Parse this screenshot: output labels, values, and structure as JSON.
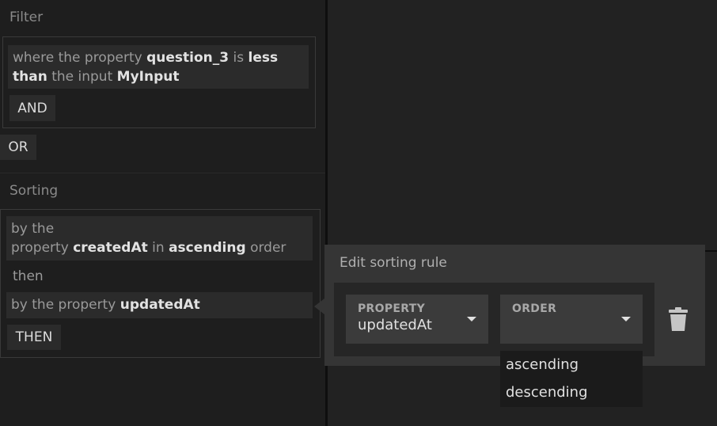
{
  "filter": {
    "title": "Filter",
    "rule": {
      "prefix": "where the property",
      "property": "question_3",
      "is_word": "is",
      "operator_a": "less",
      "operator_b": "than",
      "input_word": "the input",
      "input_name": "MyInput"
    },
    "and_label": "AND",
    "or_label": "OR"
  },
  "sorting": {
    "title": "Sorting",
    "rule1": {
      "prefix_line1": "by the",
      "prefix_line2": "property",
      "property": "createdAt",
      "in_word": "in",
      "order": "ascending",
      "suffix": "order"
    },
    "then_word": "then",
    "rule2": {
      "prefix": "by the property",
      "property": "updatedAt"
    },
    "then_button": "THEN"
  },
  "editor": {
    "title": "Edit sorting rule",
    "property_label": "PROPERTY",
    "property_value": "updatedAt",
    "order_label": "ORDER",
    "order_value": "",
    "options": [
      "ascending",
      "descending"
    ],
    "icons": {
      "property_caret": "chevron-down-icon",
      "order_caret": "chevron-down-icon",
      "delete": "trash-icon"
    }
  }
}
